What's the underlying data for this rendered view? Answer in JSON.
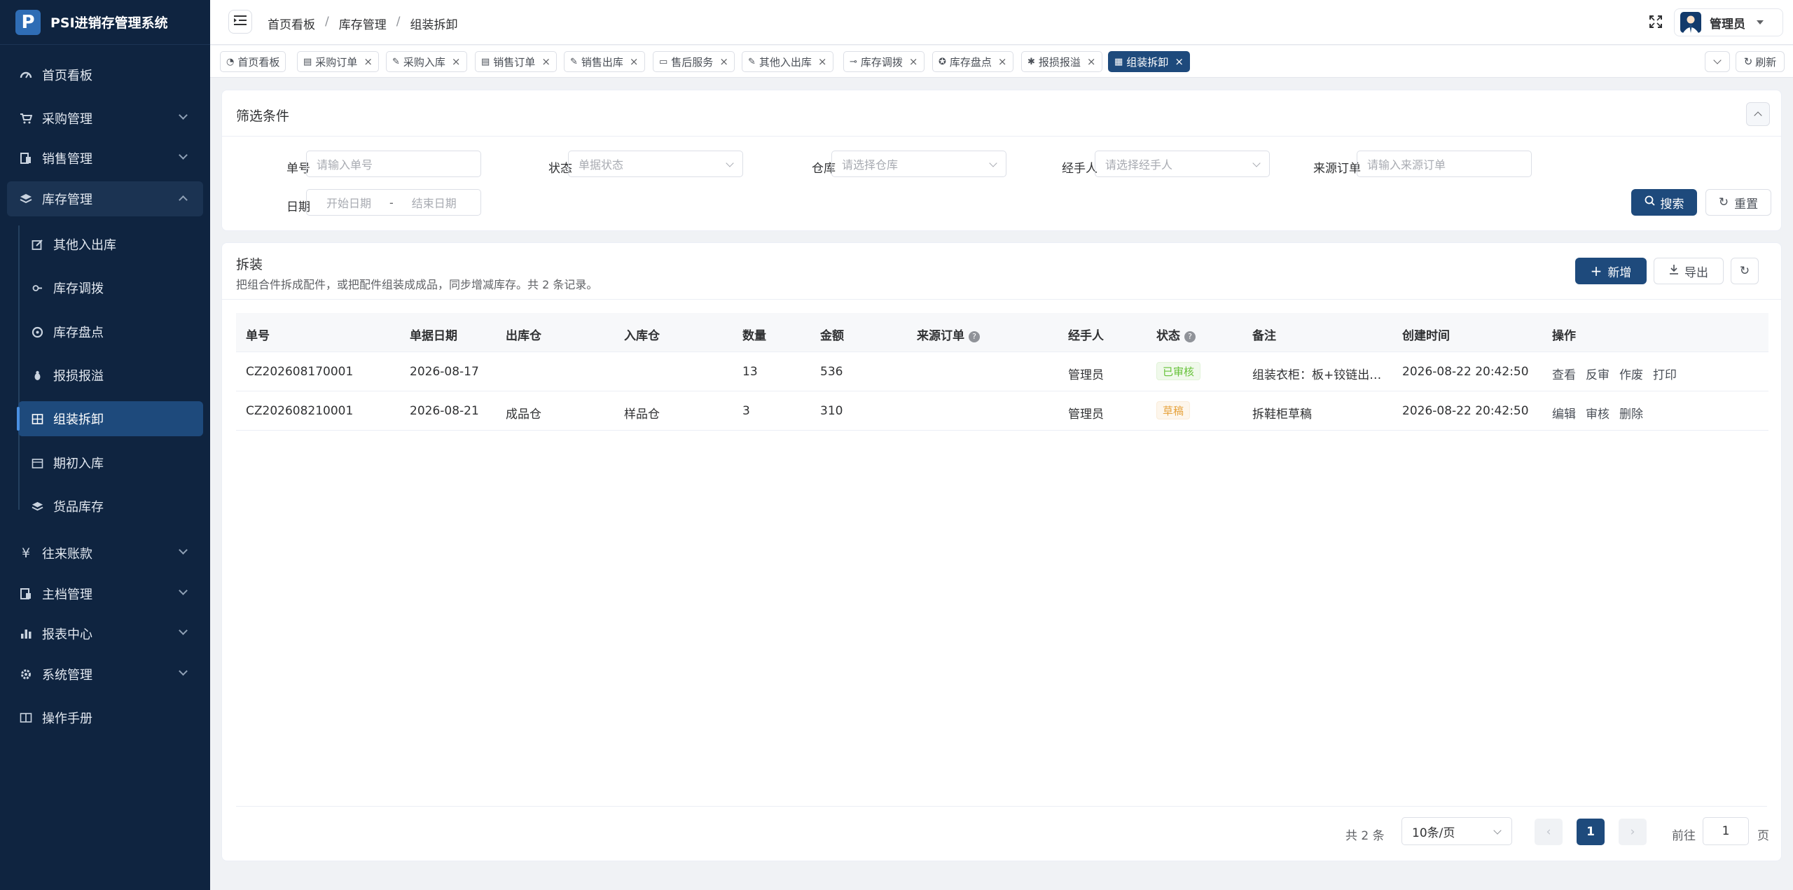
{
  "app": {
    "title": "PSI进销存管理系统",
    "logo_letter": "P"
  },
  "sidebar": {
    "items": [
      {
        "label": "首页看板",
        "icon": "dashboard-icon"
      },
      {
        "label": "采购管理",
        "icon": "cart-icon"
      },
      {
        "label": "销售管理",
        "icon": "sales-icon"
      },
      {
        "label": "库存管理",
        "icon": "stack-icon"
      },
      {
        "label": "其他入出库",
        "icon": "edit-icon"
      },
      {
        "label": "库存调拨",
        "icon": "transfer-icon"
      },
      {
        "label": "库存盘点",
        "icon": "count-icon"
      },
      {
        "label": "报损报溢",
        "icon": "bug-icon"
      },
      {
        "label": "组装拆卸",
        "icon": "grid-icon"
      },
      {
        "label": "期初入库",
        "icon": "calendar-icon"
      },
      {
        "label": "货品库存",
        "icon": "stack-icon"
      },
      {
        "label": "往来账款",
        "icon": "yen-icon"
      },
      {
        "label": "主档管理",
        "icon": "archive-icon"
      },
      {
        "label": "报表中心",
        "icon": "bar-chart-icon"
      },
      {
        "label": "系统管理",
        "icon": "gear-icon"
      },
      {
        "label": "操作手册",
        "icon": "book-icon"
      }
    ]
  },
  "header": {
    "breadcrumb": [
      "首页看板",
      "库存管理",
      "组装拆卸"
    ],
    "separator": "/",
    "user": "管理员"
  },
  "tabs": [
    {
      "label": "首页看板",
      "closable": false
    },
    {
      "label": "采购订单",
      "closable": true
    },
    {
      "label": "采购入库",
      "closable": true
    },
    {
      "label": "销售订单",
      "closable": true
    },
    {
      "label": "销售出库",
      "closable": true
    },
    {
      "label": "售后服务",
      "closable": true
    },
    {
      "label": "其他入出库",
      "closable": true
    },
    {
      "label": "库存调拨",
      "closable": true
    },
    {
      "label": "库存盘点",
      "closable": true
    },
    {
      "label": "报损报溢",
      "closable": true
    },
    {
      "label": "组装拆卸",
      "closable": true,
      "active": true
    }
  ],
  "tabs_refresh": "刷新",
  "filter": {
    "title": "筛选条件",
    "fields": {
      "order_no": {
        "label": "单号",
        "placeholder": "请输入单号"
      },
      "status": {
        "label": "状态",
        "placeholder": "单据状态"
      },
      "warehouse": {
        "label": "仓库",
        "placeholder": "请选择仓库"
      },
      "handler": {
        "label": "经手人",
        "placeholder": "请选择经手人"
      },
      "source": {
        "label": "来源订单",
        "placeholder": "请输入来源订单"
      },
      "date": {
        "label": "日期",
        "start_placeholder": "开始日期",
        "end_placeholder": "结束日期",
        "sep": "-"
      }
    },
    "search_label": "搜索",
    "reset_label": "重置"
  },
  "list": {
    "title": "拆装",
    "description": "把组合件拆成配件，或把配件组装成成品，同步增减库存。共 2 条记录。",
    "add_label": "新增",
    "export_label": "导出",
    "columns": [
      "单号",
      "单据日期",
      "出库仓",
      "入库仓",
      "数量",
      "金额",
      "来源订单",
      "经手人",
      "状态",
      "备注",
      "创建时间",
      "操作"
    ],
    "rows": [
      {
        "no": "CZ202608170001",
        "date": "2026-08-17",
        "out_wh": "",
        "in_wh": "",
        "qty": "13",
        "amount": "536",
        "source": "",
        "handler": "管理员",
        "status": "已审核",
        "status_type": "ok",
        "remark": "组装衣柜：板+铰链出…",
        "created": "2026-08-22 20:42:50",
        "actions": [
          "查看",
          "反审",
          "作废",
          "打印"
        ]
      },
      {
        "no": "CZ202608210001",
        "date": "2026-08-21",
        "out_wh": "成品仓",
        "in_wh": "样品仓",
        "qty": "3",
        "amount": "310",
        "source": "",
        "handler": "管理员",
        "status": "草稿",
        "status_type": "draft",
        "remark": "拆鞋柜草稿",
        "created": "2026-08-22 20:42:50",
        "actions": [
          "编辑",
          "审核",
          "删除"
        ]
      }
    ]
  },
  "pagination": {
    "total": "共 2 条",
    "page_size": "10条/页",
    "current": "1",
    "goto_label": "前往",
    "goto_value": "1",
    "page_suffix": "页"
  },
  "colors": {
    "sidebar_bg": "#0f2440",
    "primary": "#1e4a7c",
    "ok": "#67c23a",
    "draft": "#e6a23c"
  }
}
